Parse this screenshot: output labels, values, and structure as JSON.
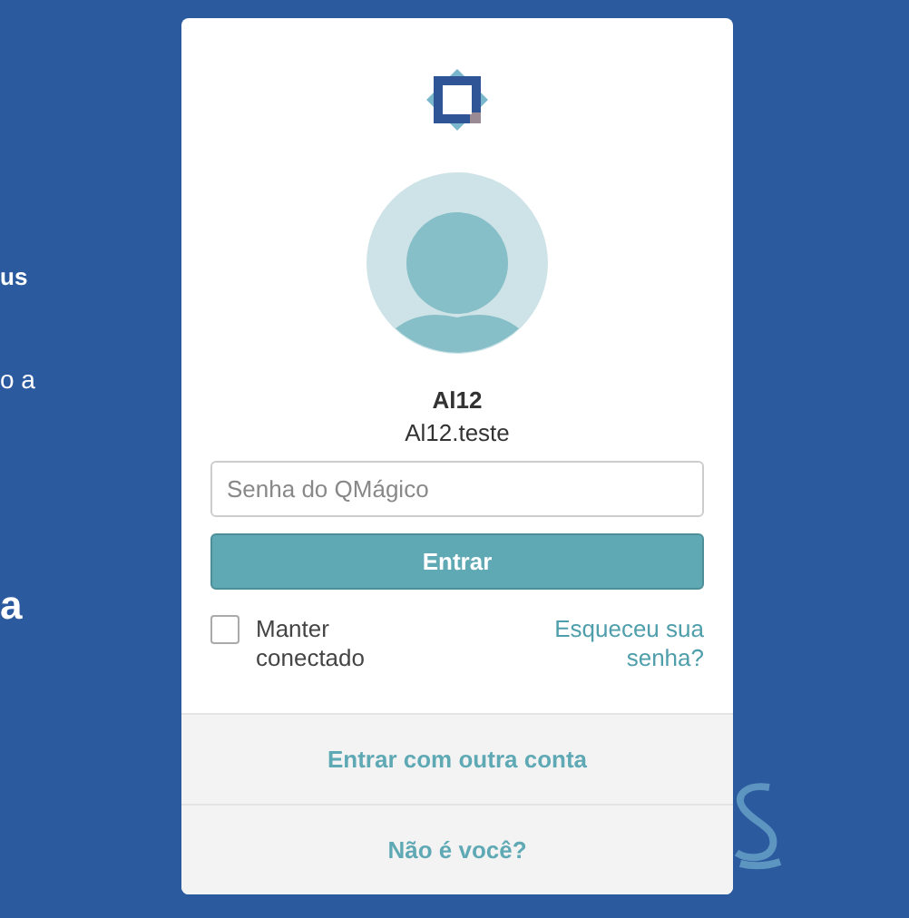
{
  "background_texts": [
    {
      "text": "us",
      "bold": true
    },
    {
      "text": "o a",
      "bold": false
    },
    {
      "text": "a",
      "bold": true
    }
  ],
  "user": {
    "name": "Al12",
    "username": "Al12.teste"
  },
  "password_field": {
    "placeholder": "Senha do QMágico"
  },
  "submit_button": "Entrar",
  "remember": {
    "label": "Manter conectado",
    "checked": false
  },
  "forgot_link": "Esqueceu sua senha?",
  "footer_links": [
    "Entrar com outra conta",
    "Não é você?"
  ]
}
